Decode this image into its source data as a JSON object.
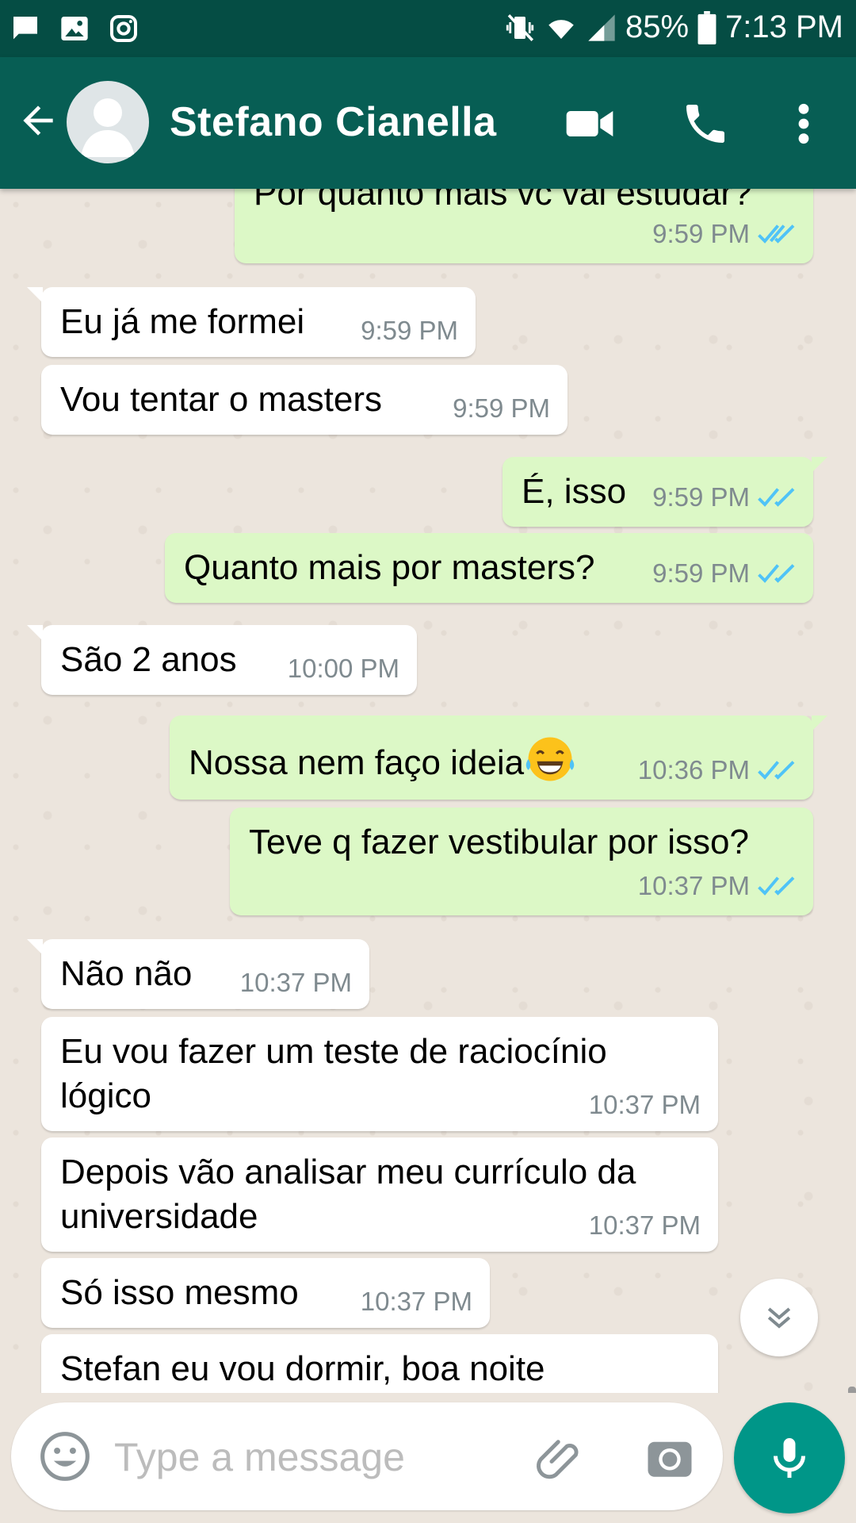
{
  "status_bar": {
    "battery": "85%",
    "time": "7:13 PM"
  },
  "header": {
    "contact_name": "Stefano Cianella"
  },
  "messages": [
    {
      "dir": "out",
      "text": "Por quanto mais vc vai estudar?",
      "time": "9:59 PM"
    },
    {
      "dir": "in",
      "text": "Eu já me formei",
      "time": "9:59 PM"
    },
    {
      "dir": "in",
      "text": "Vou tentar o masters",
      "time": "9:59 PM"
    },
    {
      "dir": "out",
      "text": "É, isso",
      "time": "9:59 PM"
    },
    {
      "dir": "out",
      "text": "Quanto mais por masters?",
      "time": "9:59 PM"
    },
    {
      "dir": "in",
      "text": "São 2 anos",
      "time": "10:00 PM"
    },
    {
      "dir": "out",
      "text": "Nossa nem faço ideia",
      "time": "10:36 PM"
    },
    {
      "dir": "out",
      "text": "Teve q fazer vestibular por isso?",
      "time": "10:37 PM"
    },
    {
      "dir": "in",
      "text": "Não não",
      "time": "10:37 PM"
    },
    {
      "dir": "in",
      "text": "Eu vou fazer um teste de raciocínio lógico",
      "time": "10:37 PM"
    },
    {
      "dir": "in",
      "text": "Depois vão analisar meu currículo da universidade",
      "time": "10:37 PM"
    },
    {
      "dir": "in",
      "text": "Só isso mesmo",
      "time": "10:37 PM"
    },
    {
      "dir": "in",
      "text": "Stefan eu vou dormir, boa noite",
      "time": ""
    }
  ],
  "composer": {
    "placeholder": "Type a message"
  },
  "colors": {
    "header": "#075e54",
    "status_bar": "#054d44",
    "outgoing": "#dcf8c6",
    "incoming": "#ffffff",
    "read_ticks": "#4fc3f7",
    "fab": "#009688"
  }
}
